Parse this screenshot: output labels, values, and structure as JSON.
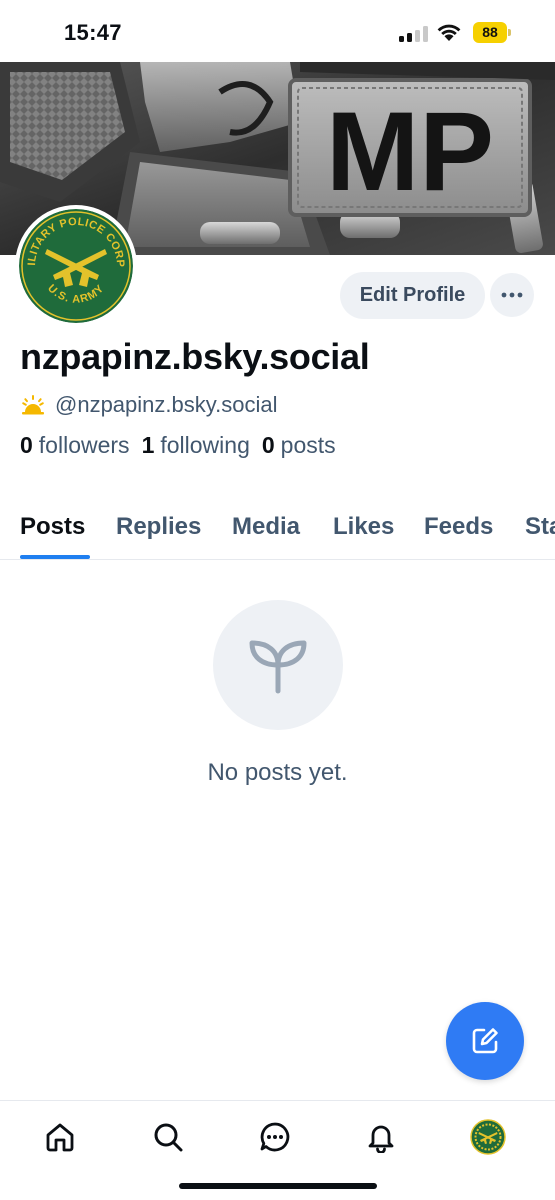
{
  "status_bar": {
    "time": "15:47",
    "battery": "88",
    "icons": [
      "cellular-signal-icon",
      "wifi-icon",
      "battery-icon"
    ]
  },
  "banner": {
    "patch_text": "MP"
  },
  "avatar": {
    "logo_text_top": "MILITARY POLICE CORPS",
    "logo_text_bottom": "U.S. ARMY",
    "colors": {
      "green": "#1f6b3b",
      "gold": "#e3c22b"
    }
  },
  "profile": {
    "edit_label": "Edit Profile",
    "more_icon": "ellipsis-icon",
    "display_name": "nzpapinz.bsky.social",
    "handle": "@nzpapinz.bsky.social",
    "handle_icon": "sunrise-emoji-icon",
    "stats": {
      "followers_count": "0",
      "followers_label": "followers",
      "following_count": "1",
      "following_label": "following",
      "posts_count": "0",
      "posts_label": "posts"
    }
  },
  "tabs": [
    {
      "label": "Posts",
      "active": true
    },
    {
      "label": "Replies"
    },
    {
      "label": "Media"
    },
    {
      "label": "Likes"
    },
    {
      "label": "Feeds"
    },
    {
      "label": "Starter Packs"
    }
  ],
  "empty_state": {
    "icon": "seedling-icon",
    "text": "No posts yet."
  },
  "fab": {
    "icon": "compose-icon"
  },
  "bottom_nav": {
    "items": [
      "home-icon",
      "search-icon",
      "chat-icon",
      "bell-icon",
      "profile-avatar"
    ]
  },
  "colors": {
    "accent": "#1f7ff0",
    "fab": "#2f7bf4",
    "muted_text": "#42576e",
    "button_bg": "#eef1f5"
  }
}
